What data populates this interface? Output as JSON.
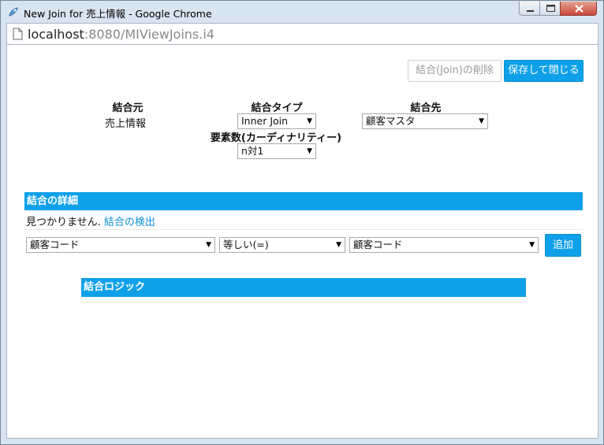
{
  "window": {
    "title": "New Join for 売上情報 - Google Chrome"
  },
  "address_bar": {
    "host": "localhost",
    "rest": ":8080/MIViewJoins.i4"
  },
  "toolbar": {
    "delete_label": "結合(Join)の削除",
    "save_close_label": "保存して閉じる"
  },
  "join_form": {
    "source_header": "結合元",
    "source_value": "売上情報",
    "type_header": "結合タイプ",
    "type_value": "Inner Join",
    "cardinality_header": "要素数(カーディナリティー)",
    "cardinality_value": "n対1",
    "target_header": "結合先",
    "target_value": "顧客マスタ"
  },
  "join_details": {
    "title": "結合の詳細",
    "not_found_text": "見つかりません.",
    "detect_link": "結合の検出",
    "left_field": "顧客コード",
    "operator": "等しい(=)",
    "right_field": "顧客コード",
    "add_label": "追加"
  },
  "join_logic": {
    "title": "結合ロジック"
  },
  "colors": {
    "accent": "#0ea0e8",
    "link": "#0e8fd6"
  }
}
